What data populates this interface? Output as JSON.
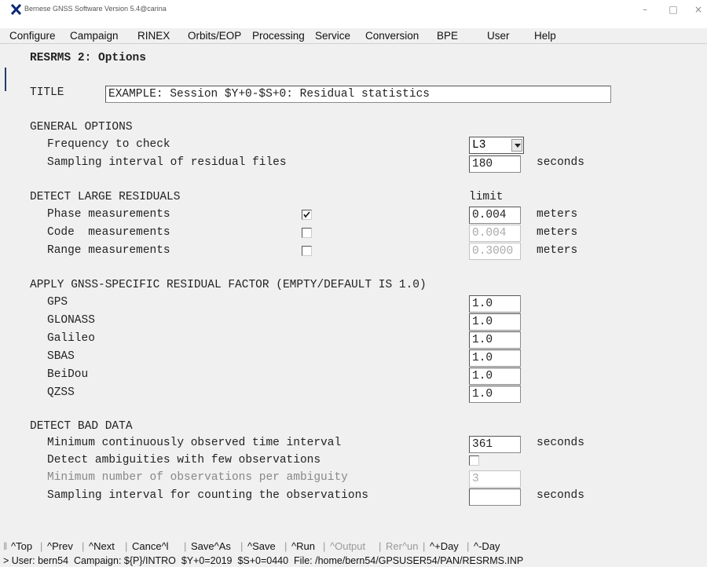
{
  "window": {
    "title": "Bernese GNSS Software Version 5.4@carina",
    "minimize": "–",
    "maximize": "□",
    "close": "×"
  },
  "menu": [
    {
      "label": "Configure"
    },
    {
      "label": "Campaign"
    },
    {
      "label": "RINEX"
    },
    {
      "label": "Orbits/EOP"
    },
    {
      "label": "Processing"
    },
    {
      "label": "Service"
    },
    {
      "label": "Conversion"
    },
    {
      "label": "BPE"
    },
    {
      "label": "User"
    },
    {
      "label": "Help"
    }
  ],
  "panel": {
    "heading": "RESRMS 2: Options",
    "title_label": "TITLE",
    "title_value": "EXAMPLE: Session $Y+0-$S+0: Residual statistics",
    "general": {
      "section": "GENERAL OPTIONS",
      "freq_label": "Frequency to check",
      "freq_value": "L3",
      "sampling_label": "Sampling interval of residual files",
      "sampling_value": "180",
      "sampling_unit": "seconds"
    },
    "large": {
      "section": "DETECT LARGE RESIDUALS",
      "limit_header": "limit",
      "phase_label": "Phase measurements",
      "phase_checked": true,
      "phase_value": "0.004",
      "code_label": "Code  measurements",
      "code_checked": false,
      "code_value": "0.004",
      "range_label": "Range measurements",
      "range_checked": false,
      "range_value": "0.3000",
      "unit": "meters"
    },
    "gnss": {
      "section": "APPLY GNSS-SPECIFIC RESIDUAL FACTOR (EMPTY/DEFAULT IS 1.0)",
      "items": [
        {
          "label": "GPS",
          "value": "1.0"
        },
        {
          "label": "GLONASS",
          "value": "1.0"
        },
        {
          "label": "Galileo",
          "value": "1.0"
        },
        {
          "label": "SBAS",
          "value": "1.0"
        },
        {
          "label": "BeiDou",
          "value": "1.0"
        },
        {
          "label": "QZSS",
          "value": "1.0"
        }
      ]
    },
    "bad": {
      "section": "DETECT BAD DATA",
      "min_interval_label": "Minimum continuously observed time interval",
      "min_interval_value": "361",
      "min_interval_unit": "seconds",
      "few_obs_label": "Detect ambiguities with few observations",
      "few_obs_checked": false,
      "min_obs_label": "Minimum number of observations per ambiguity",
      "min_obs_value": "3",
      "count_interval_label": "Sampling interval for counting the observations",
      "count_interval_value": "",
      "count_interval_unit": "seconds"
    }
  },
  "buttons": [
    {
      "label": "^Top",
      "enabled": true
    },
    {
      "label": "^Prev",
      "enabled": true
    },
    {
      "label": "^Next",
      "enabled": true
    },
    {
      "label": "Cance^l",
      "enabled": true
    },
    {
      "label": "Save^As",
      "enabled": true
    },
    {
      "label": "^Save",
      "enabled": true
    },
    {
      "label": "^Run",
      "enabled": true
    },
    {
      "label": "^Output",
      "enabled": false
    },
    {
      "label": "Rer^un",
      "enabled": false
    },
    {
      "label": "^+Day",
      "enabled": true
    },
    {
      "label": "^-Day",
      "enabled": true
    }
  ],
  "status": "> User: bern54  Campaign: ${P}/INTRO  $Y+0=2019  $S+0=0440  File: /home/bern54/GPSUSER54/PAN/RESRMS.INP"
}
